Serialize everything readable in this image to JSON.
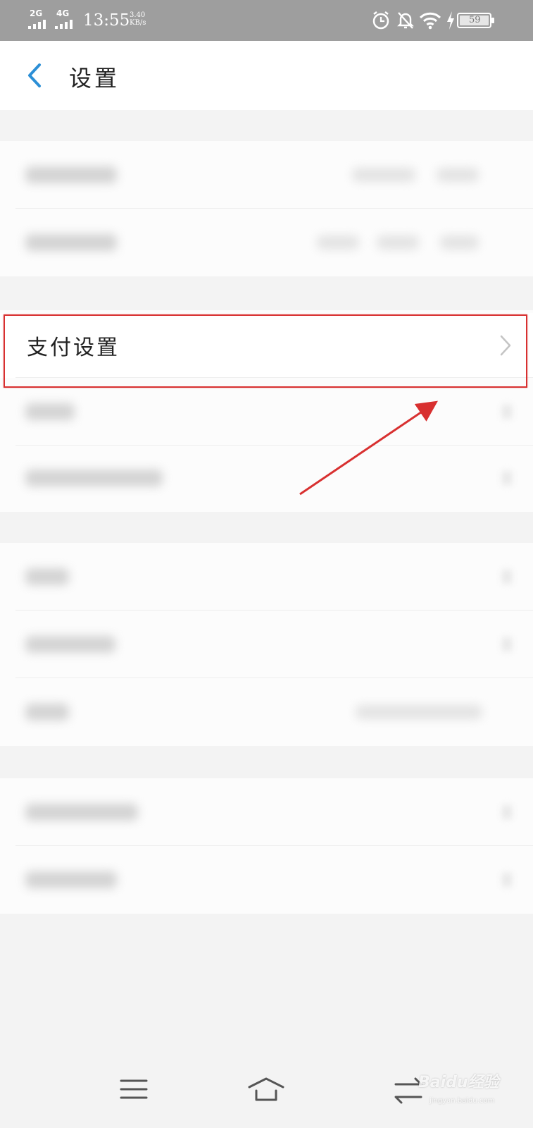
{
  "status_bar": {
    "network_1": "2G",
    "network_2": "4G",
    "time": "13:55",
    "speed_value": "3.40",
    "speed_unit": "KB/s",
    "battery": "59",
    "icons": [
      "alarm-icon",
      "silent-bell-icon",
      "wifi-icon",
      "charging-icon",
      "battery-icon"
    ]
  },
  "header": {
    "title": "设置",
    "back_icon": "chevron-left-icon"
  },
  "settings": {
    "payment_settings_label": "支付设置"
  },
  "nav_bar": {
    "icons": [
      "menu-icon",
      "home-icon",
      "back-icon"
    ]
  },
  "watermark": {
    "brand": "Baidu经验",
    "url": "jingyan.baidu.com"
  },
  "colors": {
    "accent": "#2c8fd6",
    "annotation": "#d83030",
    "status_bar": "#9e9e9e"
  }
}
